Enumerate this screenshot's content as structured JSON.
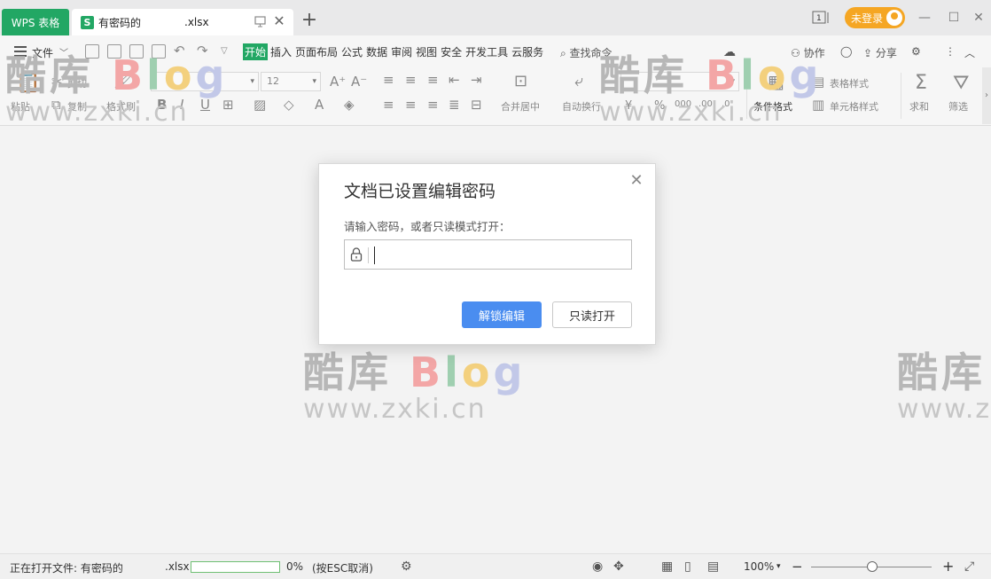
{
  "title_bar": {
    "app_tab": "WPS 表格",
    "doc_tab": {
      "icon": "S",
      "name": "有密码的",
      "ext": ".xlsx"
    },
    "new_tab": "+",
    "login_label": "未登录",
    "page_indicator": "1",
    "brand_color": "#22a764",
    "login_color": "#f5a623"
  },
  "menu": {
    "file": "文件",
    "tabs": [
      "开始",
      "插入",
      "页面布局",
      "公式",
      "数据",
      "审阅",
      "视图",
      "安全",
      "开发工具",
      "云服务"
    ],
    "active_tab": "开始",
    "search": "查找命令",
    "collab": "协作",
    "share": "分享"
  },
  "ribbon": {
    "cut": "剪切",
    "paste": "粘贴",
    "copy": "复制",
    "format_painter": "格式刷",
    "font_size": "12",
    "merge_center": "合并居中",
    "wrap_text": "自动换行",
    "currency": "¥",
    "percent": "%",
    "cond_format": "条件格式",
    "table_style": "表格样式",
    "cell_style": "单元格样式",
    "sum": "求和",
    "filter": "筛选"
  },
  "watermark": {
    "brand_cn": "酷库",
    "brand_en": "Blog",
    "url": "www.zxki.cn"
  },
  "dialog": {
    "title": "文档已设置编辑密码",
    "prompt": "请输入密码，或者只读模式打开：",
    "password_value": "",
    "unlock_button": "解锁编辑",
    "readonly_button": "只读打开",
    "primary_color": "#4a8df0"
  },
  "status_bar": {
    "opening_text": "正在打开文件: 有密码的",
    "ext": ".xlsx",
    "progress_percent": 0,
    "progress_label": "0%",
    "cancel_hint": "(按ESC取消)",
    "zoom": "100%",
    "zoom_minus": "−",
    "zoom_plus": "+"
  }
}
